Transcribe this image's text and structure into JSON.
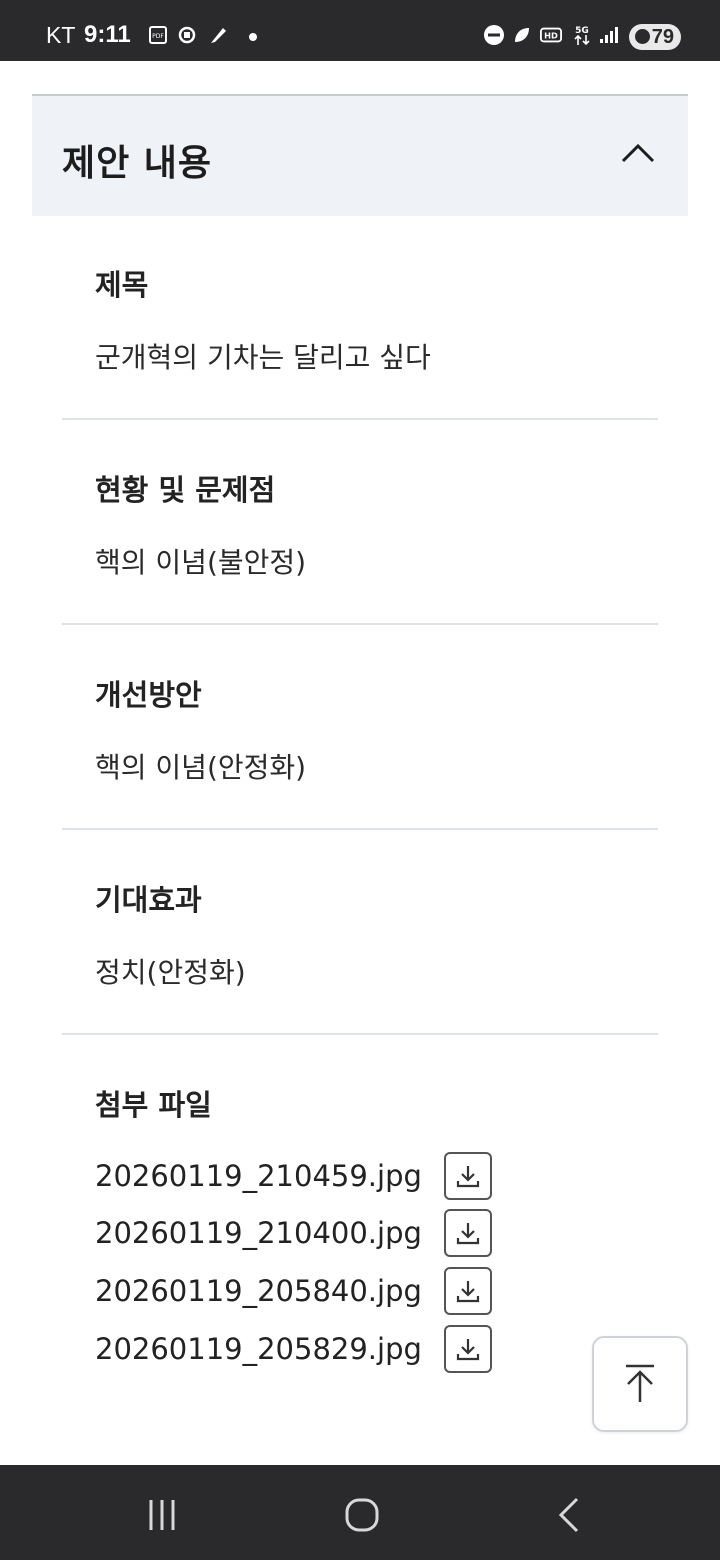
{
  "status_bar": {
    "carrier": "KT",
    "time": "9:11",
    "battery": "79",
    "icons": [
      "pdf-icon",
      "sync-icon",
      "feather-icon",
      "dnd-icon",
      "leaf-icon",
      "hd-icon",
      "5g-icon",
      "signal-icon",
      "battery-icon"
    ],
    "text_color": "#ffffff",
    "background": "#2a2a2c"
  },
  "section": {
    "title": "제안 내용",
    "expanded": true,
    "header_background": "#eff2f7"
  },
  "fields": [
    {
      "label": "제목",
      "value": "군개혁의 기차는 달리고 싶다"
    },
    {
      "label": "현황 및 문제점",
      "value": "핵의 이념(불안정)"
    },
    {
      "label": "개선방안",
      "value": "핵의 이념(안정화)"
    },
    {
      "label": "기대효과",
      "value": "정치(안정화)"
    }
  ],
  "attachments": {
    "label": "첨부 파일",
    "files": [
      "20260119_210459.jpg",
      "20260119_210400.jpg",
      "20260119_205840.jpg",
      "20260119_205829.jpg"
    ]
  },
  "nav_bar": {
    "buttons": [
      "recent-apps-icon",
      "home-icon",
      "back-icon"
    ]
  }
}
